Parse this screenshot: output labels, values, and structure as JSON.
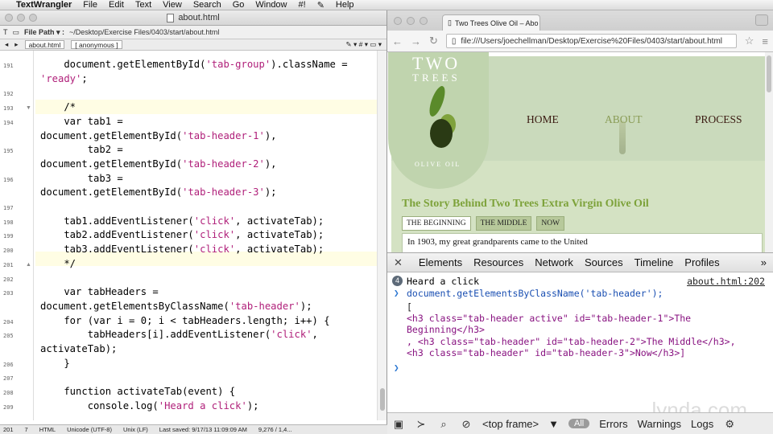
{
  "menubar": {
    "apple": "",
    "app": "TextWrangler",
    "items": [
      "File",
      "Edit",
      "Text",
      "View",
      "Search",
      "Go",
      "Window",
      "#!",
      "✎",
      "Help"
    ]
  },
  "textwrangler": {
    "title": "about.html",
    "path_label": "File Path ▾ :",
    "path": "~/Desktop/Exercise Files/0403/start/about.html",
    "nav_file": "about.html",
    "nav_func": "[ anonymous ]",
    "lines": [
      {
        "n": "191",
        "text": "    document.getElementById('tab-group').className ="
      },
      {
        "n": "",
        "text": "'ready';"
      },
      {
        "n": "192",
        "text": ""
      },
      {
        "n": "193",
        "text": "    /*"
      },
      {
        "n": "194",
        "text": "    var tab1 ="
      },
      {
        "n": "",
        "text": "document.getElementById('tab-header-1'),"
      },
      {
        "n": "195",
        "text": "        tab2 ="
      },
      {
        "n": "",
        "text": "document.getElementById('tab-header-2'),"
      },
      {
        "n": "196",
        "text": "        tab3 ="
      },
      {
        "n": "",
        "text": "document.getElementById('tab-header-3');"
      },
      {
        "n": "197",
        "text": ""
      },
      {
        "n": "198",
        "text": "    tab1.addEventListener('click', activateTab);"
      },
      {
        "n": "199",
        "text": "    tab2.addEventListener('click', activateTab);"
      },
      {
        "n": "200",
        "text": "    tab3.addEventListener('click', activateTab);"
      },
      {
        "n": "201",
        "text": "    */"
      },
      {
        "n": "202",
        "text": ""
      },
      {
        "n": "203",
        "text": "    var tabHeaders ="
      },
      {
        "n": "",
        "text": "document.getElementsByClassName('tab-header');"
      },
      {
        "n": "204",
        "text": "    for (var i = 0; i < tabHeaders.length; i++) {"
      },
      {
        "n": "205",
        "text": "        tabHeaders[i].addEventListener('click',"
      },
      {
        "n": "",
        "text": "activateTab);"
      },
      {
        "n": "206",
        "text": "    }"
      },
      {
        "n": "207",
        "text": ""
      },
      {
        "n": "208",
        "text": "    function activateTab(event) {"
      },
      {
        "n": "209",
        "text": "        console.log('Heard a click');"
      }
    ],
    "status": {
      "line": "201",
      "col": "7",
      "lang": "HTML",
      "encoding": "Unicode (UTF-8)",
      "linebreaks": "Unix (LF)",
      "saved": "Last saved: 9/17/13 11:09:09 AM",
      "size": "9,276 / 1,4..."
    }
  },
  "chrome": {
    "tab_title": "Two Trees Olive Oil – Abo",
    "url": "file:///Users/joechellman/Desktop/Exercise%20Files/0403/start/about.html"
  },
  "site": {
    "logo_line1": "TWO",
    "logo_line2": "TREES",
    "logo_sub": "OLIVE OIL",
    "nav": [
      "HOME",
      "ABOUT",
      "PROCESS"
    ],
    "heading": "The Story Behind Two Trees Extra Virgin Olive Oil",
    "tabs": [
      "THE BEGINNING",
      "THE MIDDLE",
      "NOW"
    ],
    "panel_text": "In 1903, my great grandparents came to the United"
  },
  "devtools": {
    "tabs": [
      "Elements",
      "Resources",
      "Network",
      "Sources",
      "Timeline",
      "Profiles"
    ],
    "log_count": "4",
    "log_text": "Heard a click",
    "log_src": "about.html:202",
    "cmd": "document.getElementsByClassName('tab-header');",
    "result_open": "[",
    "r1a": "<h3 class=\"tab-header active\" id=\"tab-header-1\">The",
    "r1b": "Beginning</h3>",
    "r2": ", <h3 class=\"tab-header\" id=\"tab-header-2\">The Middle</h3>,",
    "r3": "<h3 class=\"tab-header\" id=\"tab-header-3\">Now</h3>]",
    "frame": "<top frame>",
    "filters": [
      "All",
      "Errors",
      "Warnings",
      "Logs"
    ]
  },
  "watermark": "lynda.com"
}
